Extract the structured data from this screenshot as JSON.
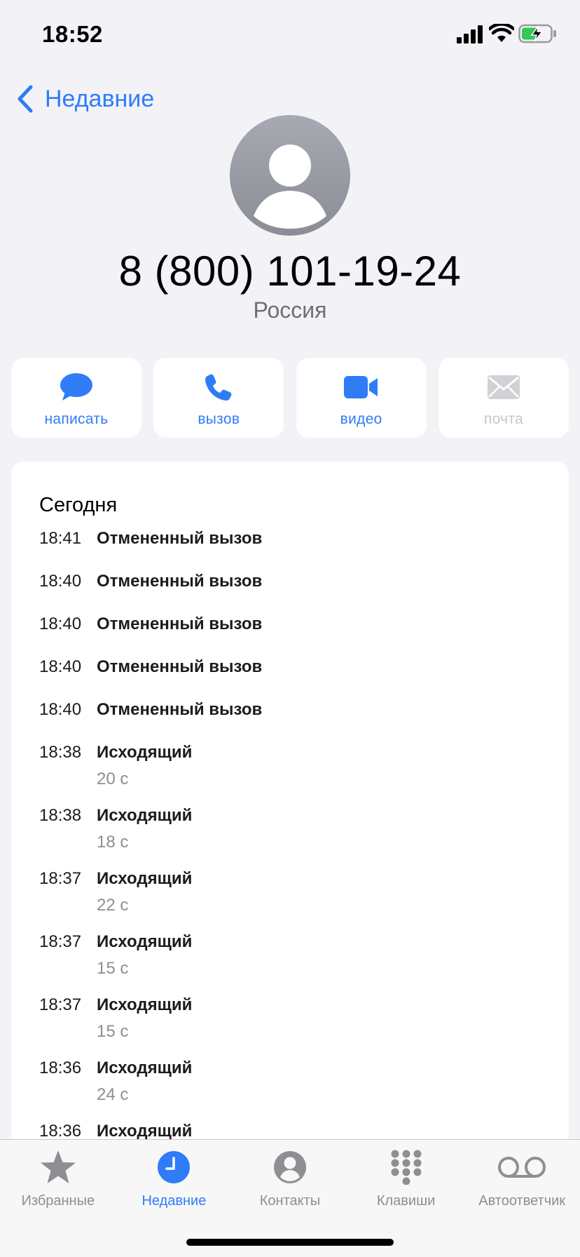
{
  "status_bar": {
    "time": "18:52"
  },
  "nav": {
    "back_label": "Недавние"
  },
  "contact": {
    "phone_number": "8 (800) 101-19-24",
    "country": "Россия"
  },
  "actions": [
    {
      "label": "написать",
      "icon": "message-icon",
      "enabled": true
    },
    {
      "label": "вызов",
      "icon": "phone-icon",
      "enabled": true
    },
    {
      "label": "видео",
      "icon": "video-icon",
      "enabled": true
    },
    {
      "label": "почта",
      "icon": "mail-icon",
      "enabled": false
    }
  ],
  "recents": {
    "section_title": "Сегодня",
    "entries": [
      {
        "time": "18:41",
        "type": "Отмененный вызов",
        "duration": ""
      },
      {
        "time": "18:40",
        "type": "Отмененный вызов",
        "duration": ""
      },
      {
        "time": "18:40",
        "type": "Отмененный вызов",
        "duration": ""
      },
      {
        "time": "18:40",
        "type": "Отмененный вызов",
        "duration": ""
      },
      {
        "time": "18:40",
        "type": "Отмененный вызов",
        "duration": ""
      },
      {
        "time": "18:38",
        "type": "Исходящий",
        "duration": "20 с"
      },
      {
        "time": "18:38",
        "type": "Исходящий",
        "duration": "18 с"
      },
      {
        "time": "18:37",
        "type": "Исходящий",
        "duration": "22 с"
      },
      {
        "time": "18:37",
        "type": "Исходящий",
        "duration": "15 с"
      },
      {
        "time": "18:37",
        "type": "Исходящий",
        "duration": "15 с"
      },
      {
        "time": "18:36",
        "type": "Исходящий",
        "duration": "24 с"
      },
      {
        "time": "18:36",
        "type": "Исходящий",
        "duration": ""
      }
    ]
  },
  "tab_bar": {
    "tabs": [
      {
        "label": "Избранные",
        "icon": "star-icon",
        "active": false
      },
      {
        "label": "Недавние",
        "icon": "clock-icon",
        "active": true
      },
      {
        "label": "Контакты",
        "icon": "person-icon",
        "active": false
      },
      {
        "label": "Клавиши",
        "icon": "keypad-icon",
        "active": false
      },
      {
        "label": "Автоответчик",
        "icon": "voicemail-icon",
        "active": false
      }
    ]
  },
  "colors": {
    "accent": "#2f7cf6",
    "background": "#f2f2f7",
    "disabled": "#c7c7cc",
    "secondary_text": "#8e8e93"
  }
}
